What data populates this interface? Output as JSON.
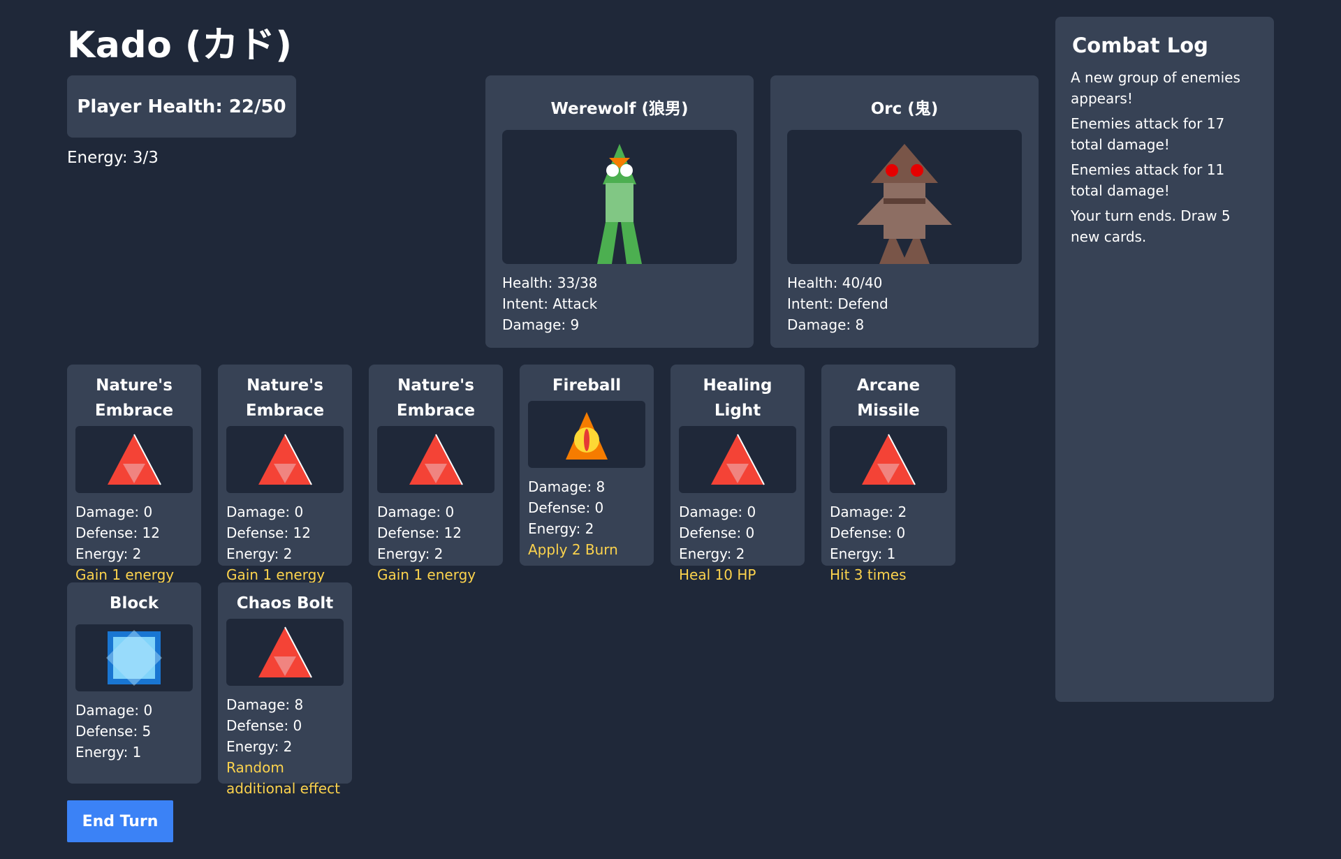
{
  "game": {
    "title": "Kado (カド)"
  },
  "player": {
    "health_label": "Player Health: 22/50",
    "energy_label": "Energy: 3/3"
  },
  "enemies": [
    {
      "name": "Werewolf (狼男)",
      "health": "Health: 33/38",
      "intent": "Intent: Attack",
      "damage": "Damage: 9",
      "icon": "werewolf-sprite"
    },
    {
      "name": "Orc (鬼)",
      "health": "Health: 40/40",
      "intent": "Intent: Defend",
      "damage": "Damage: 8",
      "icon": "orc-sprite"
    }
  ],
  "hand": [
    {
      "name": "Nature's Embrace",
      "damage": "Damage: 0",
      "defense": "Defense: 12",
      "energy": "Energy: 2",
      "effect": "Gain 1 energy",
      "icon": "red-triangle-icon"
    },
    {
      "name": "Nature's Embrace",
      "damage": "Damage: 0",
      "defense": "Defense: 12",
      "energy": "Energy: 2",
      "effect": "Gain 1 energy",
      "icon": "red-triangle-icon"
    },
    {
      "name": "Nature's Embrace",
      "damage": "Damage: 0",
      "defense": "Defense: 12",
      "energy": "Energy: 2",
      "effect": "Gain 1 energy",
      "icon": "red-triangle-icon"
    },
    {
      "name": "Fireball",
      "damage": "Damage: 8",
      "defense": "Defense: 0",
      "energy": "Energy: 2",
      "effect": "Apply 2 Burn",
      "icon": "fireball-icon"
    },
    {
      "name": "Healing Light",
      "damage": "Damage: 0",
      "defense": "Defense: 0",
      "energy": "Energy: 2",
      "effect": "Heal 10 HP",
      "icon": "red-triangle-icon"
    },
    {
      "name": "Arcane Missile",
      "damage": "Damage: 2",
      "defense": "Defense: 0",
      "energy": "Energy: 1",
      "effect": "Hit 3 times",
      "icon": "red-triangle-icon"
    },
    {
      "name": "Block",
      "damage": "Damage: 0",
      "defense": "Defense: 5",
      "energy": "Energy: 1",
      "effect": "",
      "icon": "shield-block-icon"
    },
    {
      "name": "Chaos Bolt",
      "damage": "Damage: 8",
      "defense": "Defense: 0",
      "energy": "Energy: 2",
      "effect": "Random additional effect",
      "icon": "red-triangle-icon"
    }
  ],
  "controls": {
    "end_turn_label": "End Turn"
  },
  "log": {
    "title": "Combat Log",
    "entries": [
      "A new group of enemies appears!",
      "Enemies attack for 17 total damage!",
      "Enemies attack for 11 total damage!",
      "Your turn ends. Draw 5 new cards."
    ]
  },
  "colors": {
    "background": "#1f2839",
    "panel": "#374255",
    "accent": "#3b82f6",
    "effect": "#fcd34d"
  }
}
